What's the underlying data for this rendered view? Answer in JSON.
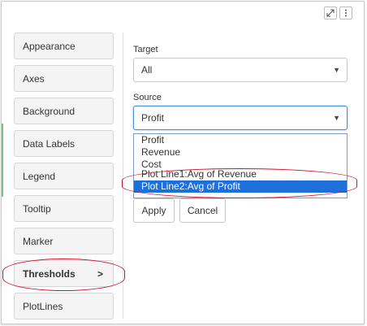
{
  "toolbar": {
    "icons": [
      "expand-icon",
      "kebab-menu-icon"
    ]
  },
  "nav": {
    "items": [
      {
        "label": "Appearance"
      },
      {
        "label": "Axes"
      },
      {
        "label": "Background"
      },
      {
        "label": "Data Labels"
      },
      {
        "label": "Legend"
      },
      {
        "label": "Tooltip"
      },
      {
        "label": "Marker"
      },
      {
        "label": "Thresholds",
        "arrow": ">",
        "active": true
      },
      {
        "label": "PlotLines"
      }
    ]
  },
  "form": {
    "target_label": "Target",
    "target_value": "All",
    "source_label": "Source",
    "source_value": "Profit",
    "caret": "▼",
    "source_options": [
      "Profit",
      "Revenue",
      "Cost",
      "Plot Line1:Avg of Revenue",
      "Plot Line2:Avg of Profit"
    ],
    "highlighted_option": "Plot Line2:Avg of Profit",
    "apply_label": "Apply",
    "cancel_label": "Cancel"
  },
  "colors": {
    "highlight": "#1e6fd9",
    "annotation": "#d0102a",
    "focus_border": "#4a90d9"
  }
}
